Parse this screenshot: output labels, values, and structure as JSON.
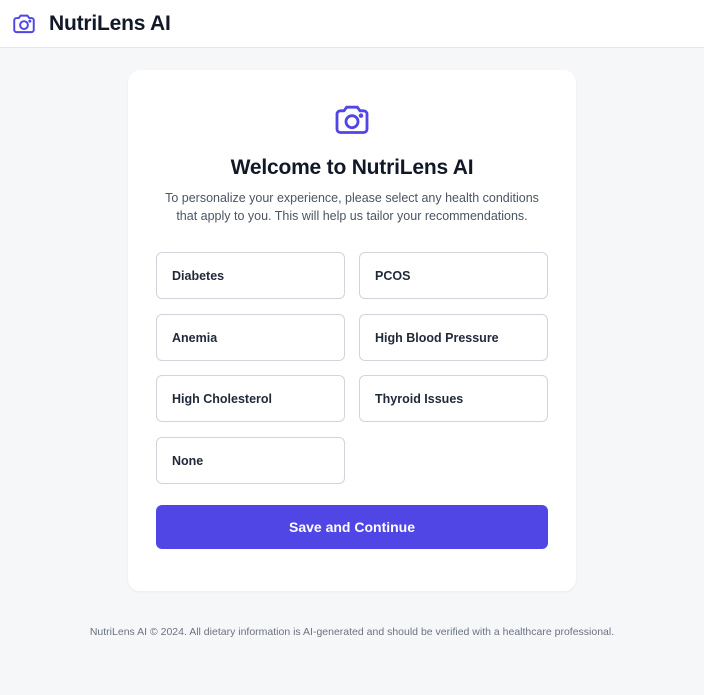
{
  "header": {
    "brand": "NutriLens AI",
    "logo_icon": "camera-icon",
    "accent_color": "#4f46e5"
  },
  "card": {
    "icon": "camera-icon",
    "title": "Welcome to NutriLens AI",
    "intro": "To personalize your experience, please select any health conditions that apply to you. This will help us tailor your recommendations.",
    "options": [
      "Diabetes",
      "PCOS",
      "Anemia",
      "High Blood Pressure",
      "High Cholesterol",
      "Thyroid Issues",
      "None"
    ],
    "save_label": "Save and Continue"
  },
  "footer": {
    "text": "NutriLens AI © 2024. All dietary information is AI-generated and should be verified with a healthcare professional."
  }
}
